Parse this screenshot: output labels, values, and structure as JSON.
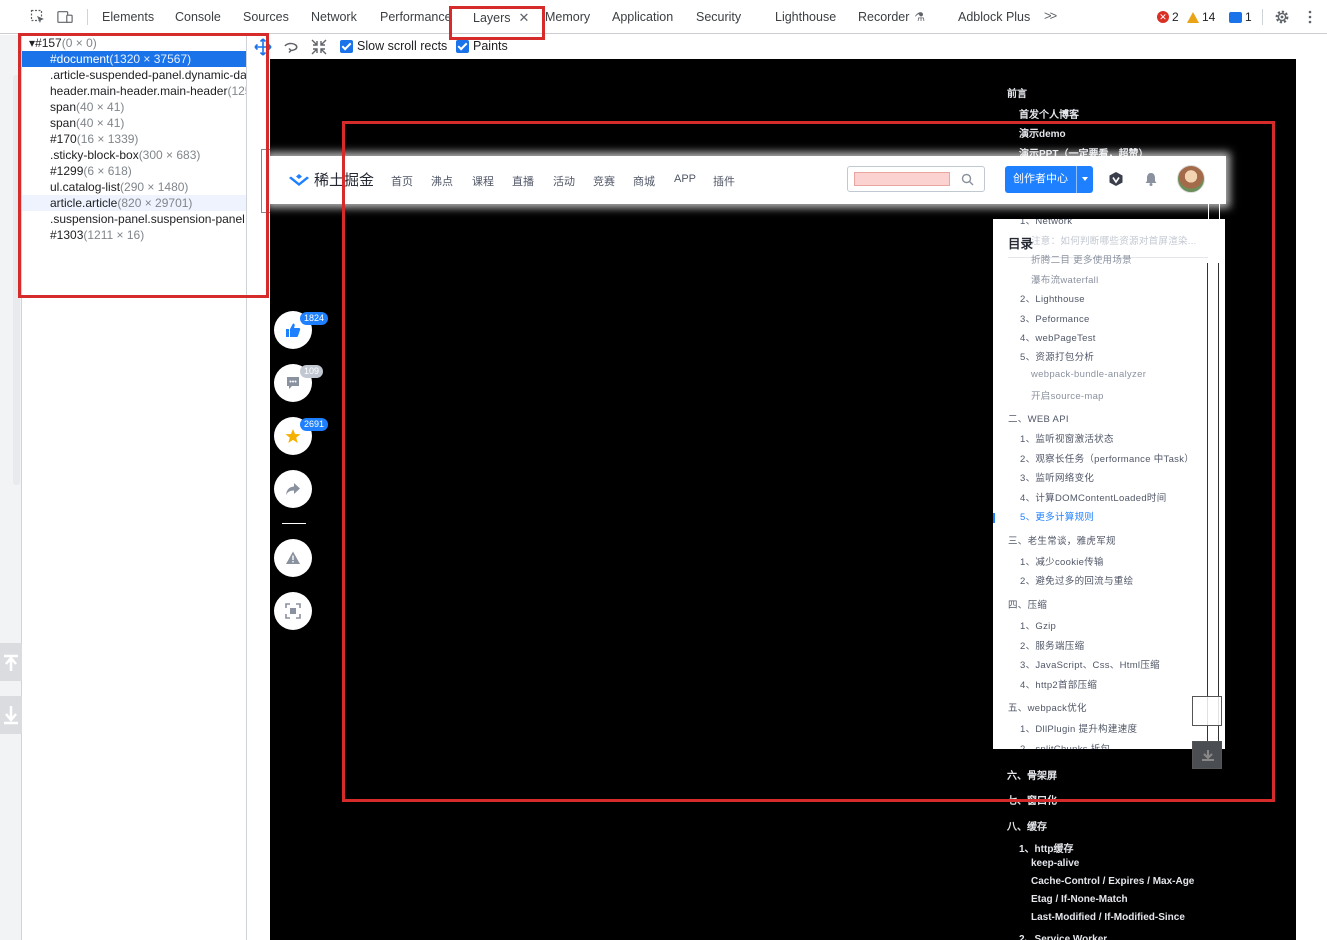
{
  "tabs": {
    "items": [
      {
        "label": "Elements"
      },
      {
        "label": "Console"
      },
      {
        "label": "Sources"
      },
      {
        "label": "Network"
      },
      {
        "label": "Performance"
      },
      {
        "label": "Layers",
        "active": true
      },
      {
        "label": "Memory"
      },
      {
        "label": "Application"
      },
      {
        "label": "Security"
      },
      {
        "label": "Lighthouse"
      },
      {
        "label": "Recorder"
      },
      {
        "label": "Adblock Plus"
      }
    ],
    "more_icon": "double-chevron-right-icon",
    "close_icon": "close-icon",
    "recorder_icon": "flask-icon"
  },
  "status": {
    "errors": "2",
    "warnings": "14",
    "messages": "1",
    "error_color": "#d93025",
    "warning_color": "#e8a317",
    "message_color": "#1a73e8"
  },
  "layer_tree": {
    "rows": [
      {
        "name": "▾#157",
        "dims": "(0 × 0)"
      },
      {
        "name": "#document",
        "dims": "(1320 × 37567)",
        "selected": true
      },
      {
        "name": ".article-suspended-panel.dynamic-da",
        "dims": ""
      },
      {
        "name": "header.main-header.main-header",
        "dims": "(125"
      },
      {
        "name": "span",
        "dims": "(40 × 41)"
      },
      {
        "name": "span",
        "dims": "(40 × 41)"
      },
      {
        "name": "#170",
        "dims": "(16 × 1339)"
      },
      {
        "name": ".sticky-block-box",
        "dims": "(300 × 683)"
      },
      {
        "name": "#1299",
        "dims": "(6 × 618)"
      },
      {
        "name": "ul.catalog-list",
        "dims": "(290 × 1480)"
      },
      {
        "name": "article.article",
        "dims": "(820 × 29701)",
        "hover": true
      },
      {
        "name": ".suspension-panel.suspension-panel",
        "dims": ""
      },
      {
        "name": "#1303",
        "dims": "(1211 × 16)"
      }
    ]
  },
  "toolbar": {
    "pan_icon": "pan-mode-icon",
    "rotate_icon": "rotate-mode-icon",
    "reset_icon": "reset-transform-icon",
    "slow_scroll_label": "Slow scroll rects",
    "slow_scroll_checked": true,
    "paints_label": "Paints",
    "paints_checked": true
  },
  "page_header": {
    "logo_text": "稀土掘金",
    "nav": [
      "首页",
      "沸点",
      "课程",
      "直播",
      "活动",
      "竞赛",
      "商城",
      "APP",
      "插件"
    ],
    "creator_button": "创作者中心",
    "brand_color": "#1e80ff"
  },
  "side_actions": [
    {
      "icon": "thumbs-up-icon",
      "count": "1824"
    },
    {
      "icon": "comment-icon",
      "count": "109"
    },
    {
      "icon": "star-icon",
      "count": "2691"
    },
    {
      "icon": "share-icon",
      "count": ""
    },
    {
      "icon": "warning-icon",
      "count": ""
    },
    {
      "icon": "fullscreen-icon",
      "count": ""
    }
  ],
  "toc_behind": {
    "above": [
      "前言",
      "首发个人博客",
      "演示demo",
      "演示PPT（一定要看，超赞）"
    ],
    "below": [
      "六、骨架屏",
      "七、窗口化",
      "八、缓存",
      "1、http缓存",
      "keep-alive",
      "Cache-Control / Expires / Max-Age",
      "Etag / If-None-Match",
      "Last-Modified / If-Modified-Since",
      "2、Service Worker"
    ]
  },
  "toc_card": {
    "title": "目录",
    "items": [
      {
        "text": "1、Network",
        "level": 2
      },
      {
        "text": "注意：如何判断哪些资源对首屏渲染...",
        "level": 3
      },
      {
        "text": "折腾二目 更多使用场景",
        "level": 3
      },
      {
        "text": "瀑布流waterfall",
        "level": 3
      },
      {
        "text": "2、Lighthouse",
        "level": 2
      },
      {
        "text": "3、Peformance",
        "level": 2
      },
      {
        "text": "4、webPageTest",
        "level": 2
      },
      {
        "text": "5、资源打包分析",
        "level": 2
      },
      {
        "text": "webpack-bundle-analyzer",
        "level": 3
      },
      {
        "text": "开启source-map",
        "level": 3
      },
      {
        "text": "二、WEB API",
        "level": 1
      },
      {
        "text": "1、监听视窗激活状态",
        "level": 2
      },
      {
        "text": "2、观察长任务（performance 中Task）",
        "level": 2
      },
      {
        "text": "3、监听网络变化",
        "level": 2
      },
      {
        "text": "4、计算DOMContentLoaded时间",
        "level": 2
      },
      {
        "text": "5、更多计算规则",
        "level": 2,
        "active": true
      },
      {
        "text": "三、老生常谈，雅虎军规",
        "level": 1
      },
      {
        "text": "1、减少cookie传输",
        "level": 2
      },
      {
        "text": "2、避免过多的回流与重绘",
        "level": 2
      },
      {
        "text": "四、压缩",
        "level": 1
      },
      {
        "text": "1、Gzip",
        "level": 2
      },
      {
        "text": "2、服务端压缩",
        "level": 2
      },
      {
        "text": "3、JavaScript、Css、Html压缩",
        "level": 2
      },
      {
        "text": "4、http2首部压缩",
        "level": 2
      },
      {
        "text": "五、webpack优化",
        "level": 1
      },
      {
        "text": "1、DllPlugin 提升构建速度",
        "level": 2
      },
      {
        "text": "2、splitChunks 拆包",
        "level": 2
      }
    ]
  }
}
